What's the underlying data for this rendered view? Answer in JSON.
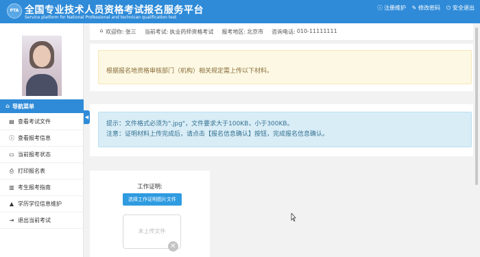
{
  "header": {
    "logo_text": "PTA",
    "title": "全国专业技术人员资格考试报名服务平台",
    "subtitle": "Service platform for National Professional and technican qualification test",
    "links": [
      {
        "label": "注册维护",
        "icon": "info-circle-icon",
        "glyph": "ⓘ"
      },
      {
        "label": "修改密码",
        "icon": "edit-icon",
        "glyph": "✎"
      },
      {
        "label": "安全退出",
        "icon": "power-icon",
        "glyph": "⏻"
      }
    ]
  },
  "sidebar": {
    "nav_header": {
      "label": "导航菜单",
      "icon": "home-icon",
      "glyph": "⌂"
    },
    "collapse_glyph": "◀",
    "items": [
      {
        "label": "查看考试文件",
        "icon": "file-icon",
        "glyph": "▤"
      },
      {
        "label": "查看报考信息",
        "icon": "info-icon",
        "glyph": "ⓘ"
      },
      {
        "label": "当前报考状态",
        "icon": "monitor-icon",
        "glyph": "▭"
      },
      {
        "label": "打印报名表",
        "icon": "print-icon",
        "glyph": "⎙"
      },
      {
        "label": "考生报考指南",
        "icon": "book-icon",
        "glyph": "▥"
      },
      {
        "label": "学历学位信息维护",
        "icon": "graduation-cap-icon",
        "glyph": "▲"
      },
      {
        "label": "退出当前考试",
        "icon": "sign-out-icon",
        "glyph": "⇥"
      }
    ]
  },
  "info_bar": {
    "icon": "bank-icon",
    "glyph": "⌂",
    "welcome_label": "欢迎你:",
    "welcome_name": "张三",
    "exam_label": "当前考试:",
    "exam_value": "执业药师资格考试",
    "region_label": "报考地区:",
    "region_value": "北京市",
    "phone_label": "咨询电话:",
    "phone_value": "010-11111111"
  },
  "alerts": {
    "warning": "根据报名地资格审核部门（机构）相关规定需上传以下材料。",
    "info_line1": "提示：文件格式必须为\".jpg\"，文件要求大于100KB，小于300KB。",
    "info_line2": "注意：证明材料上传完成后，请点击【报名信息确认】按钮，完成报名信息确认。"
  },
  "upload": {
    "title": "工作证明:",
    "button_label": "选择工作证明图片文件",
    "placeholder": "未上传文件",
    "remove_glyph": "✕"
  },
  "colors": {
    "primary": "#2f8bd8",
    "warning_bg": "#fcf8e3",
    "info_bg": "#d9edf7"
  }
}
